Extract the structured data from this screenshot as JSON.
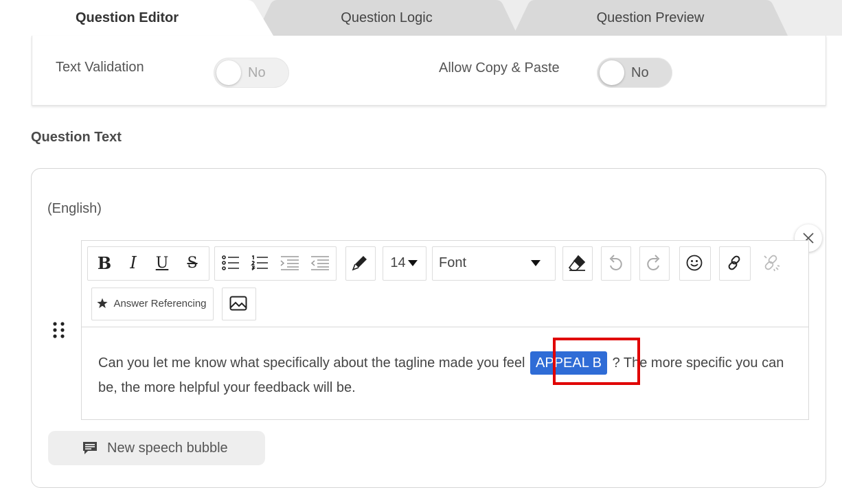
{
  "tabs": [
    {
      "label": "Question Editor",
      "active": true
    },
    {
      "label": "Question Logic",
      "active": false
    },
    {
      "label": "Question Preview",
      "active": false
    }
  ],
  "settings": {
    "text_validation": {
      "label": "Text Validation",
      "state": "No",
      "enabled": false
    },
    "allow_copy_paste": {
      "label": "Allow Copy & Paste",
      "state": "No",
      "enabled": false
    }
  },
  "question_text": {
    "section_title": "Question Text",
    "language": "(English)"
  },
  "toolbar": {
    "font_size": "14",
    "font_name": "Font",
    "answer_referencing_label": "Answer Referencing",
    "icons": [
      "bold-icon",
      "italic-icon",
      "underline-icon",
      "strikethrough-icon",
      "bullet-list-icon",
      "numbered-list-icon",
      "indent-icon",
      "outdent-icon",
      "text-color-icon",
      "clear-format-icon",
      "undo-icon",
      "redo-icon",
      "emoji-icon",
      "link-icon",
      "unlink-icon",
      "star-icon",
      "image-icon"
    ]
  },
  "editor_content": {
    "before": "Can you let me know what specifically about the tagline made you feel",
    "tag": "APPEAL B",
    "after": "? The more specific you can be, the more helpful your feedback will be."
  },
  "speech_bubble_button": {
    "label": "New speech bubble"
  },
  "colors": {
    "tag_bg": "#2f6cd6",
    "highlight_border": "#e00000",
    "tab_bar_bg": "#ededed",
    "inactive_tab_bg": "#d9d9d9"
  }
}
